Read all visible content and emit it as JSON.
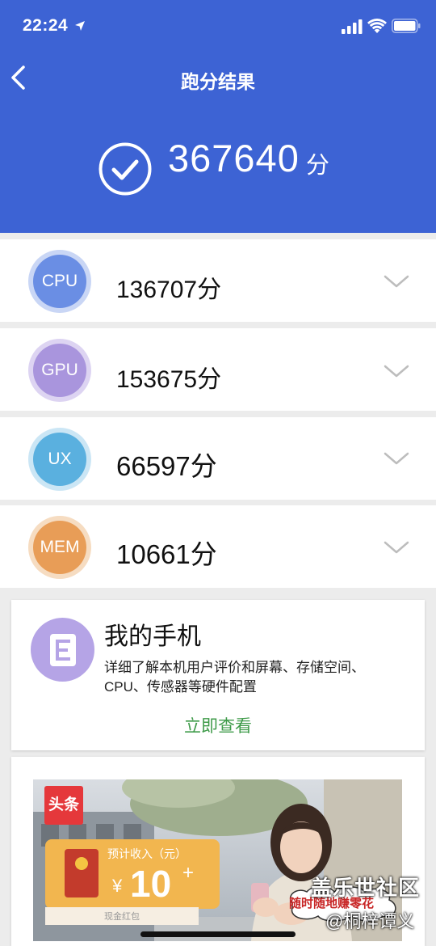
{
  "status_bar": {
    "time": "22:24"
  },
  "nav": {
    "title": "跑分结果"
  },
  "total": {
    "score": "367640",
    "unit": "分"
  },
  "categories": [
    {
      "label": "CPU",
      "score": "136707分",
      "color": "#6a8ee4",
      "ring": "#c9d6f5"
    },
    {
      "label": "GPU",
      "score": "153675分",
      "color": "#a995dd",
      "ring": "#ddd4f2"
    },
    {
      "label": "UX",
      "score": "66597分",
      "color": "#5ab0df",
      "ring": "#cbe6f5"
    },
    {
      "label": "MEM",
      "score": "10661分",
      "color": "#e89d57",
      "ring": "#f6dcc1"
    }
  ],
  "my_phone": {
    "title": "我的手机",
    "description": "详细了解本机用户评价和屏幕、存储空间、CPU、传感器等硬件配置",
    "action": "立即查看"
  },
  "ad": {
    "logo": "头条",
    "label": "预计收入（元）",
    "currency": "¥",
    "amount": "10",
    "plus": "+",
    "cash": "现金红包"
  },
  "watermark": {
    "brand": "盖乐世社区",
    "slogan": "随时随地赚零花",
    "user": "@桐梓谭义"
  },
  "icons": [
    "location-arrow-icon",
    "signal-icon",
    "wifi-icon",
    "battery-icon",
    "back-chevron-icon",
    "check-circle-icon",
    "chevron-down-icon",
    "document-icon"
  ]
}
